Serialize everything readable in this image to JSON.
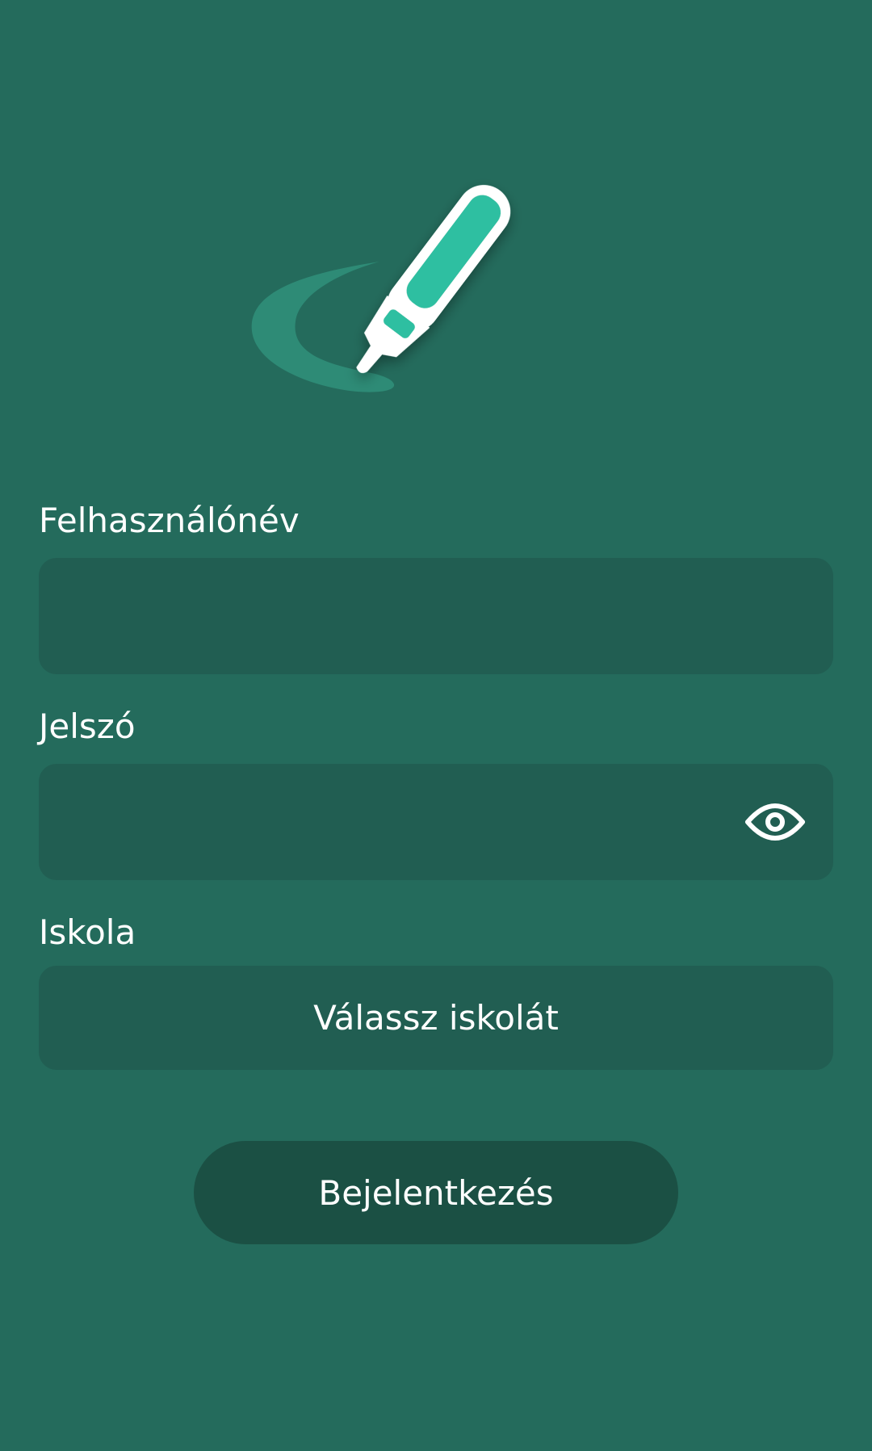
{
  "login": {
    "username_label": "Felhasználónév",
    "username_value": "",
    "password_label": "Jelszó",
    "password_value": "",
    "school_label": "Iskola",
    "school_placeholder": "Válassz iskolát",
    "submit_label": "Bejelentkezés"
  },
  "icons": {
    "logo": "highlighter-pen-logo",
    "password_toggle": "eye-icon"
  },
  "colors": {
    "background": "#246B5C",
    "field": "#215E52",
    "button": "#1B5044",
    "accent": "#2EBFA1",
    "text": "#FFFFFF"
  }
}
